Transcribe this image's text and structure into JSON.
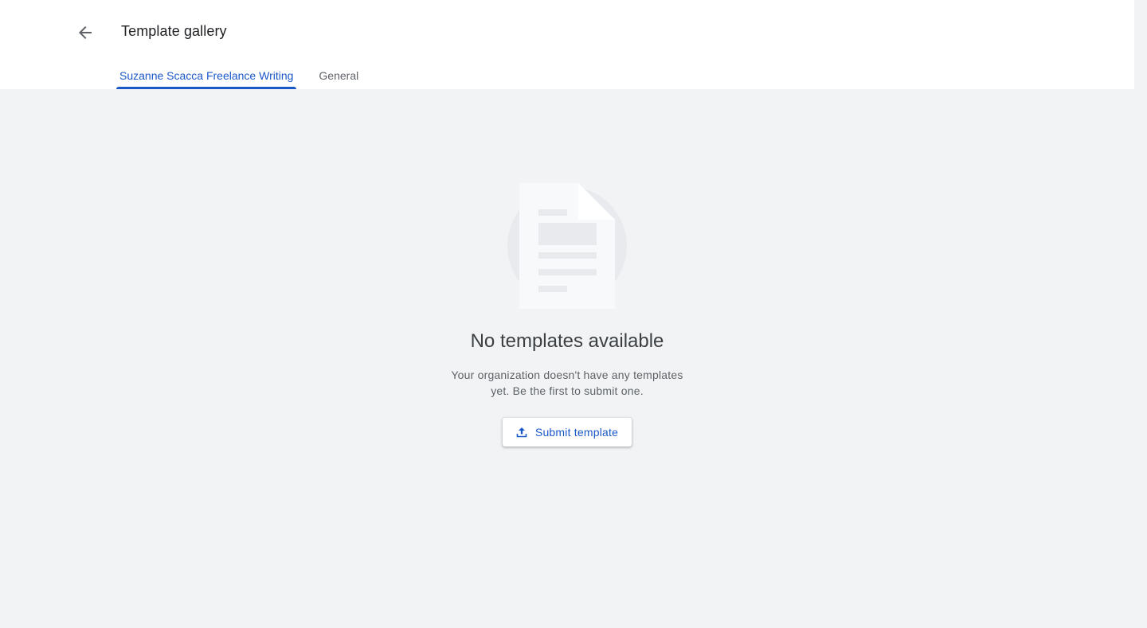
{
  "header": {
    "title": "Template gallery",
    "back_icon": "arrow-left-icon"
  },
  "tabs": [
    {
      "label": "Suzanne Scacca Freelance Writing",
      "active": true
    },
    {
      "label": "General",
      "active": false
    }
  ],
  "empty_state": {
    "illustration_icon": "document-icon",
    "title": "No templates available",
    "description": "Your organization doesn't have any templates yet. Be the first to submit one.",
    "button_label": "Submit template",
    "button_icon": "upload-icon"
  },
  "colors": {
    "accent": "#1a58c8",
    "background": "#f1f3f4",
    "header_background": "#ffffff",
    "title_text": "#202124",
    "body_text": "#5f6368"
  }
}
